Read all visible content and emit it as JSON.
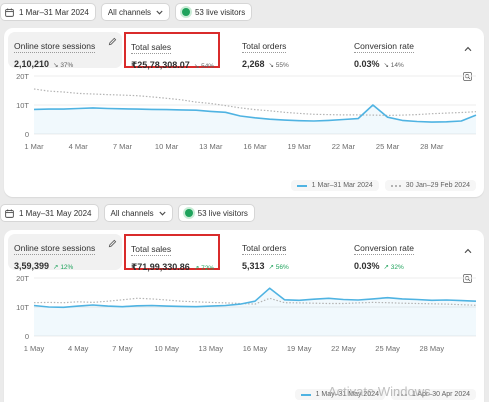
{
  "top": {
    "date_range": "1 Mar–31 Mar 2024",
    "channel": "All channels",
    "live_visitors": "53 live visitors"
  },
  "card1": {
    "metrics": [
      {
        "label": "Online store sessions",
        "value": "2,10,210",
        "change": "37%",
        "direction": "down"
      },
      {
        "label": "Total sales",
        "value": "₹25,78,308.07",
        "change": "54%",
        "direction": "down"
      },
      {
        "label": "Total orders",
        "value": "2,268",
        "change": "55%",
        "direction": "down"
      },
      {
        "label": "Conversion rate",
        "value": "0.03%",
        "change": "14%",
        "direction": "down"
      }
    ],
    "legend": {
      "current": "1 Mar–31 Mar 2024",
      "previous": "30 Jan–29 Feb 2024"
    }
  },
  "middle": {
    "date_range": "1 May–31 May 2024",
    "channel": "All channels",
    "live_visitors": "53 live visitors"
  },
  "card2": {
    "metrics": [
      {
        "label": "Online store sessions",
        "value": "3,59,399",
        "change": "12%",
        "direction": "up"
      },
      {
        "label": "Total sales",
        "value": "₹71,99,330.86",
        "change": "72%",
        "direction": "up"
      },
      {
        "label": "Total orders",
        "value": "5,313",
        "change": "56%",
        "direction": "up"
      },
      {
        "label": "Conversion rate",
        "value": "0.03%",
        "change": "32%",
        "direction": "up"
      }
    ],
    "legend": {
      "current": "1 May–31 May 2024",
      "previous": "1 Apr–30 Apr 2024"
    }
  },
  "watermark": "Activate Windows",
  "colors": {
    "current_line": "#4fb3e2",
    "previous_line": "#b3b3b3",
    "highlight_border": "#d92b2b",
    "positive": "#1fa35c",
    "negative": "#616161"
  },
  "chart_data": [
    {
      "type": "line",
      "ylim": [
        0,
        20000
      ],
      "y_ticks": [
        "0",
        "10T",
        "20T"
      ],
      "x_ticks": [
        "1 Mar",
        "4 Mar",
        "7 Mar",
        "10 Mar",
        "13 Mar",
        "16 Mar",
        "19 Mar",
        "22 Mar",
        "25 Mar",
        "28 Mar"
      ],
      "x": [
        1,
        2,
        3,
        4,
        5,
        6,
        7,
        8,
        9,
        10,
        11,
        12,
        13,
        14,
        15,
        16,
        17,
        18,
        19,
        20,
        21,
        22,
        23,
        24,
        25,
        26,
        27,
        28,
        29,
        30,
        31
      ],
      "series": [
        {
          "name": "1 Mar–31 Mar 2024",
          "values": [
            8500,
            8600,
            8600,
            8800,
            9000,
            8800,
            8700,
            8600,
            8500,
            8400,
            8300,
            8200,
            7800,
            7500,
            6200,
            5600,
            5100,
            4800,
            4600,
            4500,
            4700,
            5000,
            5300,
            10000,
            5800,
            4700,
            4300,
            4100,
            4200,
            4500,
            6500
          ]
        },
        {
          "name": "30 Jan–29 Feb 2024",
          "values": [
            15500,
            14800,
            14500,
            14000,
            13800,
            13600,
            13400,
            13200,
            12800,
            12300,
            11800,
            11000,
            10500,
            9800,
            9000,
            8400,
            8000,
            7500,
            7100,
            6800,
            6700,
            6600,
            6600,
            6500,
            6400,
            6500,
            6700,
            7000,
            7200,
            7400,
            7700
          ]
        }
      ]
    },
    {
      "type": "line",
      "ylim": [
        0,
        20000
      ],
      "y_ticks": [
        "0",
        "10T",
        "20T"
      ],
      "x_ticks": [
        "1 May",
        "4 May",
        "7 May",
        "10 May",
        "13 May",
        "16 May",
        "19 May",
        "22 May",
        "25 May",
        "28 May"
      ],
      "x": [
        1,
        2,
        3,
        4,
        5,
        6,
        7,
        8,
        9,
        10,
        11,
        12,
        13,
        14,
        15,
        16,
        17,
        18,
        19,
        20,
        21,
        22,
        23,
        24,
        25,
        26,
        27,
        28,
        29,
        30,
        31
      ],
      "series": [
        {
          "name": "1 May–31 May 2024",
          "values": [
            10500,
            10000,
            9900,
            10300,
            10700,
            10300,
            10100,
            10400,
            10500,
            10300,
            10200,
            10100,
            10300,
            10500,
            11000,
            12000,
            16500,
            12500,
            12300,
            12700,
            13000,
            12600,
            12400,
            12800,
            13200,
            12800,
            12600,
            12300,
            12400,
            12200,
            12000
          ]
        },
        {
          "name": "1 Apr–30 Apr 2024",
          "values": [
            11500,
            11600,
            11500,
            11800,
            11600,
            12000,
            12500,
            13000,
            12800,
            12400,
            12000,
            11800,
            11600,
            11400,
            11200,
            11000,
            13000,
            11500,
            11400,
            11300,
            11200,
            11200,
            11400,
            11600,
            11500,
            11300,
            11200,
            11100,
            11000,
            10800,
            10600
          ]
        }
      ]
    }
  ]
}
